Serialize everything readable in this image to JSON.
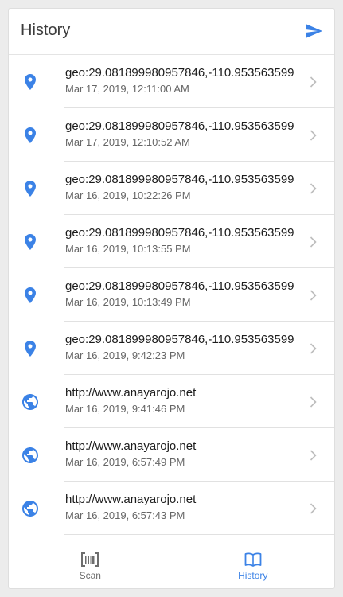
{
  "header": {
    "title": "History",
    "send_icon": "send-icon"
  },
  "colors": {
    "accent": "#3b82e6",
    "text_primary": "#1c1c1c",
    "text_secondary": "#666666",
    "chevron": "#bdbdbd"
  },
  "items": [
    {
      "icon": "location-pin-icon",
      "text": "geo:29.081899980957846,-110.953563599",
      "date": "Mar 17, 2019, 12:11:00 AM"
    },
    {
      "icon": "location-pin-icon",
      "text": "geo:29.081899980957846,-110.953563599",
      "date": "Mar 17, 2019, 12:10:52 AM"
    },
    {
      "icon": "location-pin-icon",
      "text": "geo:29.081899980957846,-110.953563599",
      "date": "Mar 16, 2019, 10:22:26 PM"
    },
    {
      "icon": "location-pin-icon",
      "text": "geo:29.081899980957846,-110.953563599",
      "date": "Mar 16, 2019, 10:13:55 PM"
    },
    {
      "icon": "location-pin-icon",
      "text": "geo:29.081899980957846,-110.953563599",
      "date": "Mar 16, 2019, 10:13:49 PM"
    },
    {
      "icon": "location-pin-icon",
      "text": "geo:29.081899980957846,-110.953563599",
      "date": "Mar 16, 2019, 9:42:23 PM"
    },
    {
      "icon": "globe-icon",
      "text": "http://www.anayarojo.net",
      "date": "Mar 16, 2019, 9:41:46 PM"
    },
    {
      "icon": "globe-icon",
      "text": "http://www.anayarojo.net",
      "date": "Mar 16, 2019, 6:57:49 PM"
    },
    {
      "icon": "globe-icon",
      "text": "http://www.anayarojo.net",
      "date": "Mar 16, 2019, 6:57:43 PM"
    }
  ],
  "tabs": [
    {
      "label": "Scan",
      "icon": "barcode-icon",
      "active": false
    },
    {
      "label": "History",
      "icon": "book-icon",
      "active": true
    }
  ]
}
